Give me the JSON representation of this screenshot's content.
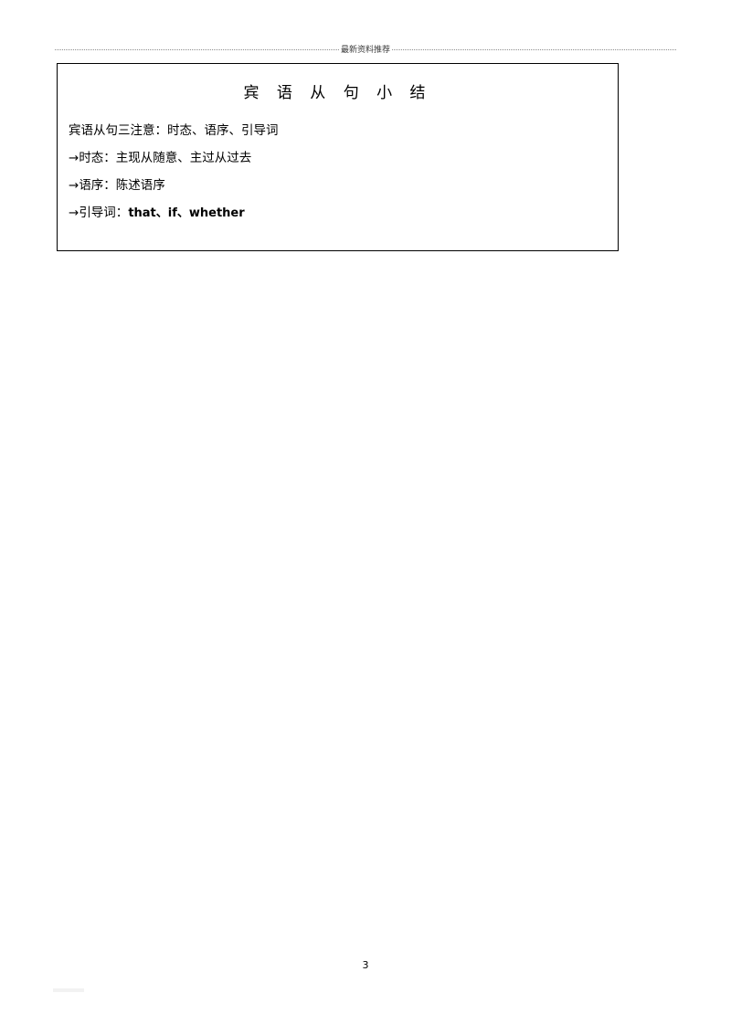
{
  "document": {
    "watermark_text": "最新资料推荐",
    "box": {
      "title": "宾 语 从 句 小 结",
      "lines": [
        {
          "id": "line-intro",
          "text": "宾语从句三注意：时态、语序、引导词",
          "arrow": "",
          "bold_tail": ""
        },
        {
          "id": "line-tense",
          "text": "时态：主现从随意、主过从过去",
          "arrow": "→",
          "bold_tail": ""
        },
        {
          "id": "line-order",
          "text": "语序：陈述语序",
          "arrow": "→",
          "bold_tail": ""
        },
        {
          "id": "line-conj",
          "text": "引导词：",
          "arrow": "→",
          "bold_tail": "that、if、whether"
        }
      ]
    },
    "page_number": "3"
  }
}
